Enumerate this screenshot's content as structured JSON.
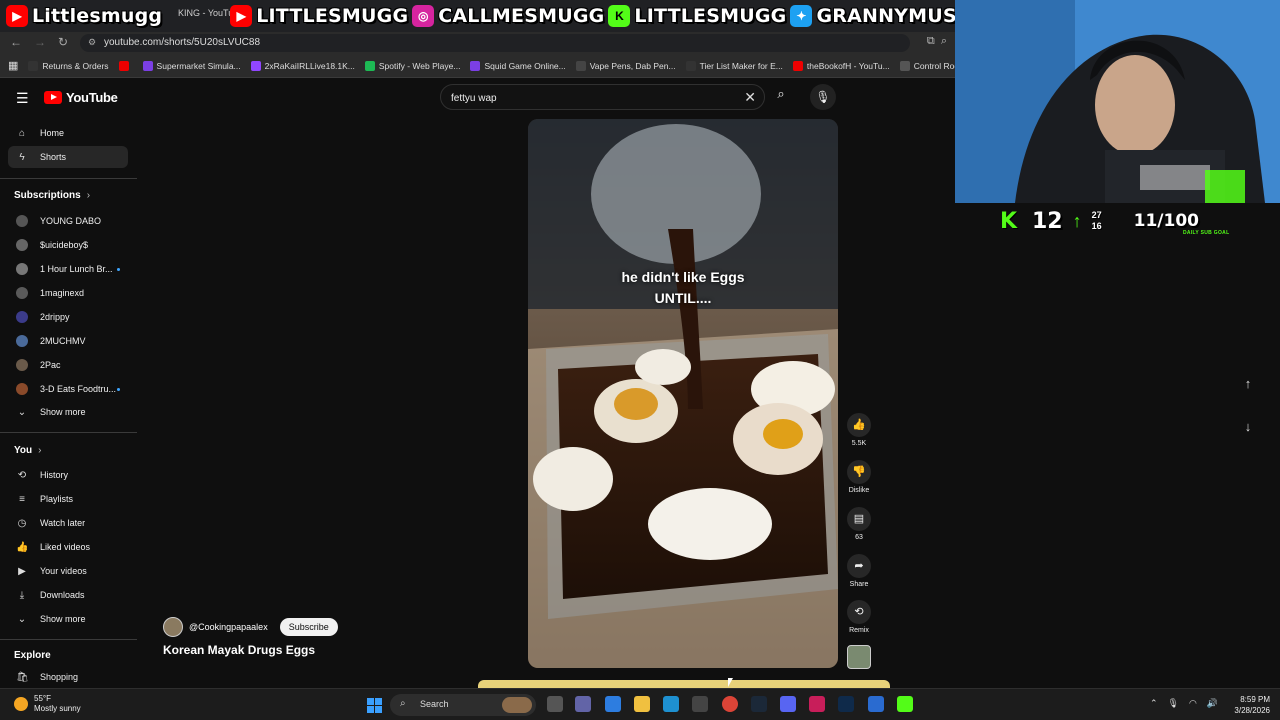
{
  "browser": {
    "tab_title": "KING - YouTube",
    "url": "youtube.com/shorts/5U20sLVUC88",
    "bookmarks": [
      {
        "label": "Returns & Orders",
        "color": "#333"
      },
      {
        "label": "",
        "color": "#e00"
      },
      {
        "label": "Supermarket Simula...",
        "color": "#7b3fe4"
      },
      {
        "label": "2xRaKaiIRLLive18.1K...",
        "color": "#9146ff"
      },
      {
        "label": "Spotify - Web Playe...",
        "color": "#1db954"
      },
      {
        "label": "Squid Game Online...",
        "color": "#7b3fe4"
      },
      {
        "label": "Vape Pens, Dab Pen...",
        "color": "#444"
      },
      {
        "label": "Tier List Maker for E...",
        "color": "#333"
      },
      {
        "label": "theBookofH - YouTu...",
        "color": "#e00"
      },
      {
        "label": "Control Room",
        "color": "#555"
      }
    ]
  },
  "overlay": {
    "handles": [
      "Littlesmugg",
      "LITTLESMUGG",
      "CALLMESMUGG",
      "LITTLESMUGG",
      "GRANNYMUSLIM"
    ]
  },
  "youtube": {
    "logo_text": "YouTube",
    "search_value": "fettyu wap",
    "sidebar": {
      "main": [
        {
          "label": "Home",
          "icon": "home-icon"
        },
        {
          "label": "Shorts",
          "icon": "shorts-icon"
        }
      ],
      "subscriptions_heading": "Subscriptions",
      "subscriptions": [
        {
          "label": "YOUNG DABO",
          "color": "#555",
          "dot": false
        },
        {
          "label": "$uicideboy$",
          "color": "#666",
          "dot": false
        },
        {
          "label": "1 Hour Lunch Br...",
          "color": "#777",
          "dot": true
        },
        {
          "label": "1maginexd",
          "color": "#5a5a5a",
          "dot": false
        },
        {
          "label": "2drippy",
          "color": "#3b3b8a",
          "dot": false
        },
        {
          "label": "2MUCHMV",
          "color": "#4a6a9a",
          "dot": false
        },
        {
          "label": "2Pac",
          "color": "#6a5a4a",
          "dot": false
        },
        {
          "label": "3-D Eats Foodtru...",
          "color": "#8a4a2a",
          "dot": true
        }
      ],
      "show_more": "Show more",
      "you_heading": "You",
      "you_items": [
        {
          "label": "History",
          "icon": "history-icon"
        },
        {
          "label": "Playlists",
          "icon": "playlists-icon"
        },
        {
          "label": "Watch later",
          "icon": "watch-later-icon"
        },
        {
          "label": "Liked videos",
          "icon": "thumbs-up-icon"
        },
        {
          "label": "Your videos",
          "icon": "your-videos-icon"
        },
        {
          "label": "Downloads",
          "icon": "download-icon"
        }
      ],
      "show_more_2": "Show more",
      "explore_heading": "Explore",
      "explore_items": [
        {
          "label": "Shopping",
          "icon": "shopping-icon"
        }
      ]
    },
    "short": {
      "caption_line1": "he didn't like Eggs",
      "caption_line2": "UNTIL....",
      "channel": "@Cookingpapaalex",
      "subscribe": "Subscribe",
      "title": "Korean Mayak Drugs Eggs"
    },
    "actions": {
      "likes": "5.5K",
      "dislike": "Dislike",
      "comments": "63",
      "share": "Share",
      "remix": "Remix"
    }
  },
  "stream": {
    "follower_delta": "12",
    "stat_top": "27",
    "stat_bottom": "16",
    "goal": "11/100",
    "goal_label": "DAILY SUB GOAL"
  },
  "taskbar": {
    "temp": "55°F",
    "weather": "Mostly sunny",
    "search": "Search",
    "time": "8:59 PM",
    "date": "3/28/2026"
  }
}
